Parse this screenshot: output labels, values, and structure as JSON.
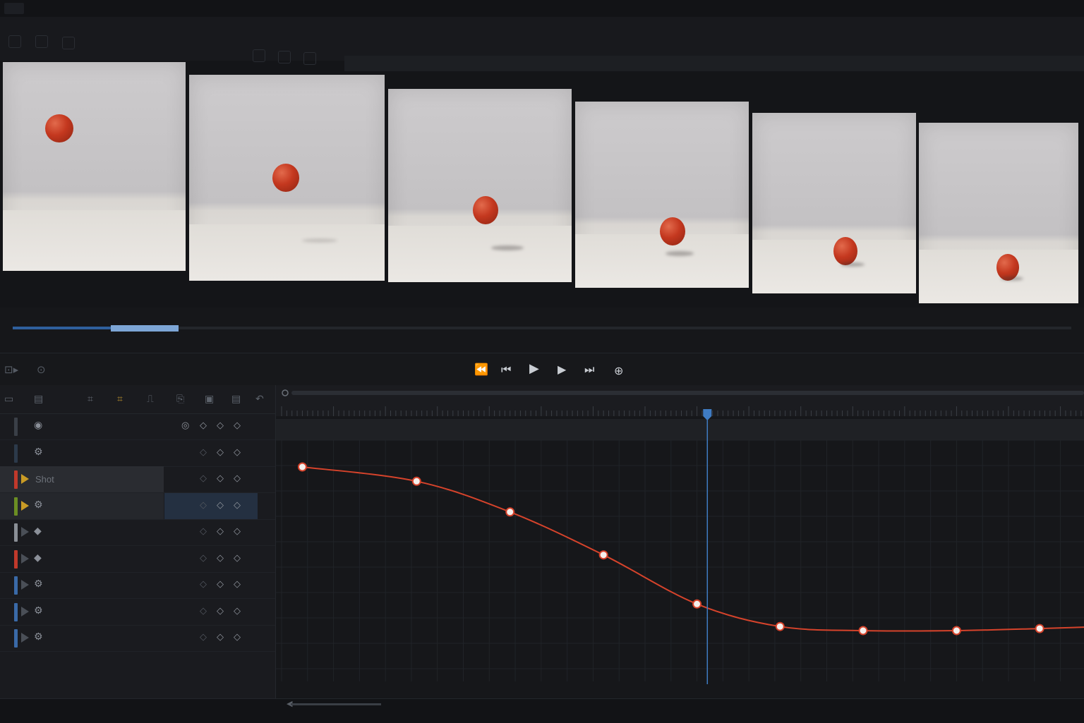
{
  "app": {
    "accent": "#3f7cc4",
    "curve_color": "#d6432b",
    "ball_color": "#c43a1f"
  },
  "toolbar": {
    "icons": [
      "new-icon",
      "folder-icon",
      "grid-icon",
      "zoom-in-icon",
      "zoom-out-icon",
      "settings-icon"
    ]
  },
  "filmstrip": {
    "frame_count": 6,
    "subject": "red ball"
  },
  "scrubber": {
    "progress": 0.14
  },
  "transport": {
    "buttons": [
      {
        "name": "rewind",
        "icon": "⏪"
      },
      {
        "name": "step-back",
        "icon": "⏮"
      },
      {
        "name": "play",
        "icon": "▶"
      },
      {
        "name": "step-forward",
        "icon": "▶"
      },
      {
        "name": "skip-end",
        "icon": "⏭"
      },
      {
        "name": "loop",
        "icon": "⊕"
      }
    ]
  },
  "layers": [
    {
      "label": "",
      "swatch": "#3a3f47",
      "icon": "◉",
      "key_icons": [
        "◎",
        "◇",
        "◇",
        "◇"
      ]
    },
    {
      "label": "",
      "swatch": "#2c3a4a",
      "icon": "⚙",
      "key_icons": [
        "◇",
        "◇",
        "◇"
      ]
    },
    {
      "label": "Shot",
      "swatch": "#c0392b",
      "icon": "",
      "key_icons": [
        "◇",
        "◇",
        "◇"
      ]
    },
    {
      "label": "",
      "swatch": "#6b8e23",
      "icon": "⚙",
      "key_icons": [
        "◇",
        "◇",
        "◇"
      ]
    },
    {
      "label": "",
      "swatch": "#8a8f96",
      "icon": "◆",
      "key_icons": [
        "◇",
        "◇",
        "◇"
      ]
    },
    {
      "label": "",
      "swatch": "#c0392b",
      "icon": "◆",
      "key_icons": [
        "◇",
        "◇",
        "◇"
      ]
    },
    {
      "label": "",
      "swatch": "#3a6aa8",
      "icon": "⚙",
      "key_icons": [
        "◇",
        "◇",
        "◇"
      ]
    },
    {
      "label": "",
      "swatch": "#3a6aa8",
      "icon": "⚙",
      "key_icons": [
        "◇",
        "◇",
        "◇"
      ]
    },
    {
      "label": "",
      "swatch": "#3a6aa8",
      "icon": "⚙",
      "key_icons": [
        "◇",
        "◇",
        "◇"
      ]
    }
  ],
  "graph": {
    "playhead_frame": 41,
    "frame_range": [
      0,
      77
    ],
    "keyframes": [
      {
        "frame": 2,
        "value": 1.0
      },
      {
        "frame": 13,
        "value": 0.93
      },
      {
        "frame": 22,
        "value": 0.78
      },
      {
        "frame": 31,
        "value": 0.57
      },
      {
        "frame": 40,
        "value": 0.33
      },
      {
        "frame": 48,
        "value": 0.22
      },
      {
        "frame": 56,
        "value": 0.2
      },
      {
        "frame": 65,
        "value": 0.2
      },
      {
        "frame": 73,
        "value": 0.21
      }
    ]
  }
}
